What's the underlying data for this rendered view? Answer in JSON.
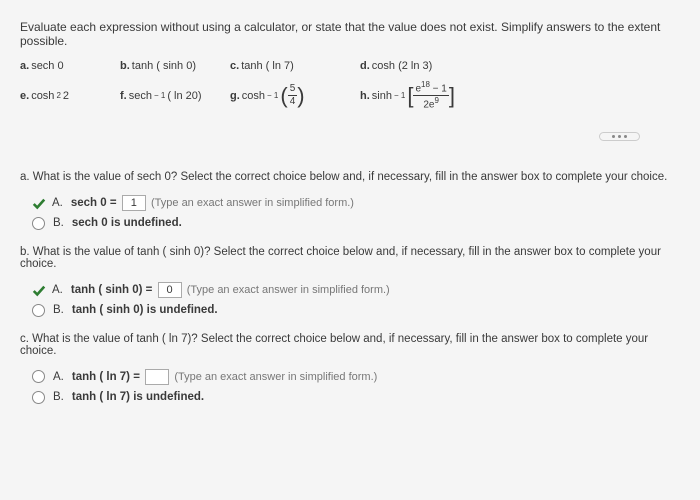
{
  "instruction": "Evaluate each expression without using a calculator, or state that the value does not exist. Simplify answers to the extent possible.",
  "expressions": {
    "a": {
      "label": "a.",
      "text": "sech 0"
    },
    "b": {
      "label": "b.",
      "text": "tanh ( sinh 0)"
    },
    "c": {
      "label": "c.",
      "text": "tanh ( ln 7)"
    },
    "d": {
      "label": "d.",
      "text": "cosh (2 ln 3)"
    },
    "e": {
      "label": "e.",
      "prefix": "cosh",
      "sup": "2",
      "suffix": "2"
    },
    "f": {
      "label": "f.",
      "prefix": "sech",
      "sup": " − 1",
      "suffix": "( ln 20)"
    },
    "g": {
      "label": "g.",
      "prefix": "cosh",
      "sup": " − 1",
      "frac_top": "5",
      "frac_bot": "4"
    },
    "h": {
      "label": "h.",
      "prefix": "sinh",
      "sup": " − 1",
      "frac_top_pre": "e",
      "frac_top_sup": "18",
      "frac_top_post": " − 1",
      "frac_bot_pre": "2e",
      "frac_bot_sup": "9"
    }
  },
  "qa": {
    "prompt": "a. What is the value of sech 0? Select the correct choice below and, if necessary, fill in the answer box to complete your choice.",
    "A_label": "A.",
    "A_pre": "sech 0 = ",
    "A_value": "1",
    "A_hint": "(Type an exact answer in simplified form.)",
    "B_label": "B.",
    "B_text": "sech 0 is undefined."
  },
  "qb": {
    "prompt": "b. What is the value of tanh ( sinh 0)? Select the correct choice below and, if necessary, fill in the answer box to complete your choice.",
    "A_label": "A.",
    "A_pre": "tanh ( sinh 0) = ",
    "A_value": "0",
    "A_hint": "(Type an exact answer in simplified form.)",
    "B_label": "B.",
    "B_text": "tanh ( sinh 0) is undefined."
  },
  "qc": {
    "prompt": "c. What is the value of tanh ( ln 7)? Select the correct choice below and, if necessary, fill in the answer box to complete your choice.",
    "A_label": "A.",
    "A_pre": "tanh ( ln 7) = ",
    "A_value": "",
    "A_hint": "(Type an exact answer in simplified form.)",
    "B_label": "B.",
    "B_text": "tanh ( ln 7) is undefined."
  }
}
